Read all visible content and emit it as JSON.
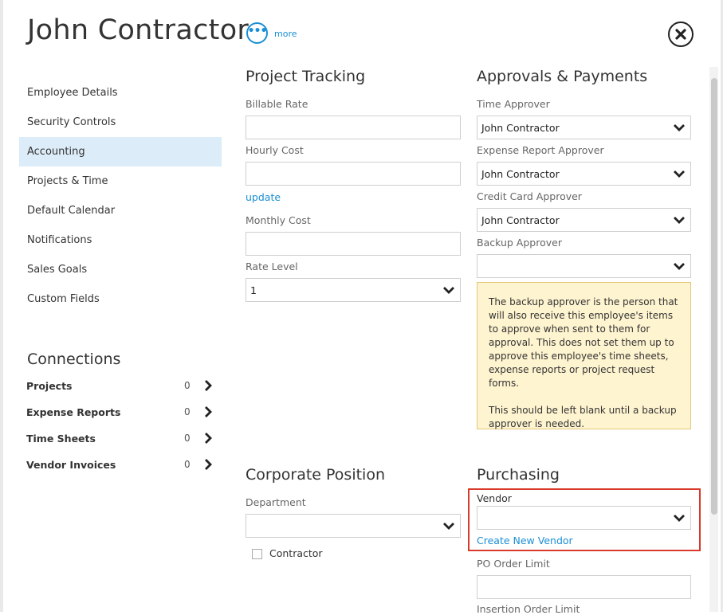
{
  "header": {
    "title": "John Contractor",
    "more_label": "more"
  },
  "sidebar": {
    "items": [
      {
        "label": "Employee Details"
      },
      {
        "label": "Security Controls"
      },
      {
        "label": "Accounting",
        "active": true
      },
      {
        "label": "Projects & Time"
      },
      {
        "label": "Default Calendar"
      },
      {
        "label": "Notifications"
      },
      {
        "label": "Sales Goals"
      },
      {
        "label": "Custom Fields"
      }
    ]
  },
  "connections": {
    "title": "Connections",
    "rows": [
      {
        "label": "Projects",
        "count": "0"
      },
      {
        "label": "Expense Reports",
        "count": "0"
      },
      {
        "label": "Time Sheets",
        "count": "0"
      },
      {
        "label": "Vendor Invoices",
        "count": "0"
      }
    ]
  },
  "project_tracking": {
    "title": "Project Tracking",
    "billable_rate_label": "Billable Rate",
    "billable_rate_value": "",
    "hourly_cost_label": "Hourly Cost",
    "hourly_cost_value": "",
    "update_link": "update",
    "monthly_cost_label": "Monthly Cost",
    "monthly_cost_value": "",
    "rate_level_label": "Rate Level",
    "rate_level_value": "1"
  },
  "approvals": {
    "title": "Approvals & Payments",
    "time_approver_label": "Time Approver",
    "time_approver_value": "John Contractor",
    "expense_approver_label": "Expense Report Approver",
    "expense_approver_value": "John Contractor",
    "credit_card_approver_label": "Credit Card Approver",
    "credit_card_approver_value": "John Contractor",
    "backup_approver_label": "Backup Approver",
    "backup_approver_value": "",
    "note_p1": "The backup approver is the person that will also receive this employee's items to approve when sent to them for approval. This does not set them up to approve this employee's time sheets, expense reports or project request forms.",
    "note_p2": "This should be left blank until a backup approver is needed."
  },
  "corporate_position": {
    "title": "Corporate Position",
    "department_label": "Department",
    "department_value": "",
    "contractor_label": "Contractor"
  },
  "purchasing": {
    "title": "Purchasing",
    "vendor_label": "Vendor",
    "vendor_value": "",
    "create_vendor_link": "Create New Vendor",
    "po_limit_label": "PO Order Limit",
    "po_limit_value": "",
    "insertion_limit_label": "Insertion Order Limit"
  },
  "colors": {
    "accent": "#1a8fd6",
    "active_nav_bg": "#dcecf8",
    "note_bg": "#fff4d0",
    "highlight_border": "#d9392b"
  }
}
